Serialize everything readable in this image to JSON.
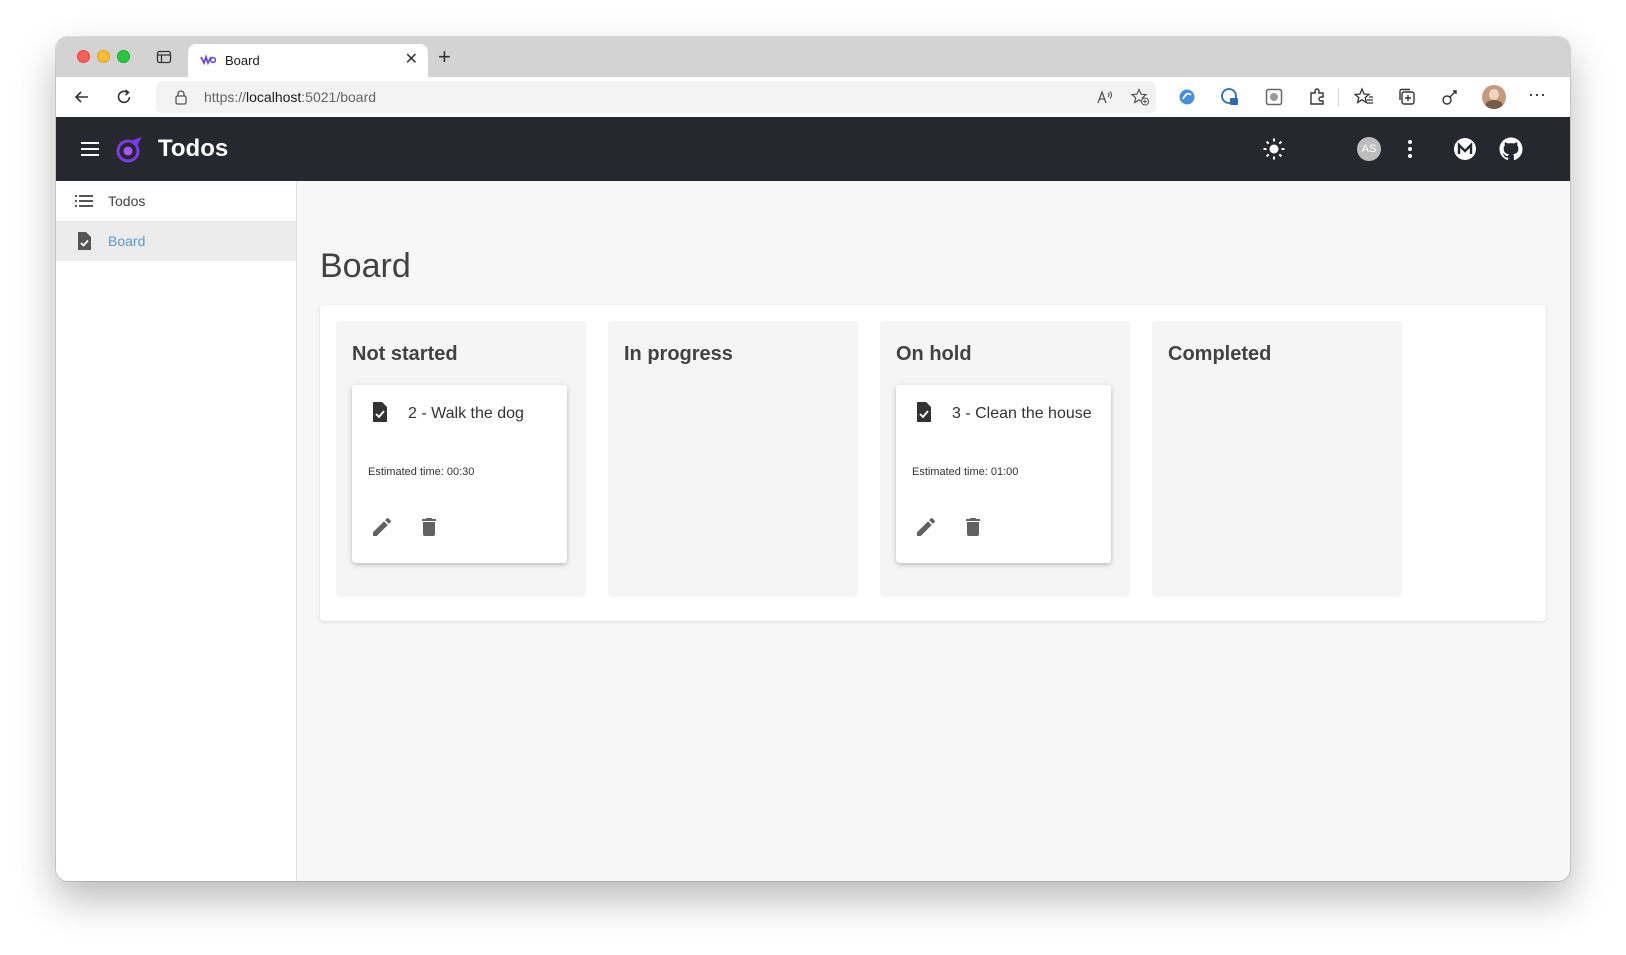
{
  "browser": {
    "tab_title": "Board",
    "url_scheme": "https://",
    "url_host": "localhost",
    "url_rest": ":5021/board"
  },
  "appbar": {
    "title": "Todos",
    "avatar_initials": "AS"
  },
  "drawer": {
    "items": [
      {
        "label": "Todos",
        "icon": "list-icon"
      },
      {
        "label": "Board",
        "icon": "task-file-icon",
        "active": true
      }
    ]
  },
  "page": {
    "title": "Board"
  },
  "board": {
    "columns": [
      {
        "title": "Not started",
        "cards": [
          {
            "title": "2 - Walk the dog",
            "estimate": "Estimated time: 00:30"
          }
        ]
      },
      {
        "title": "In progress",
        "cards": []
      },
      {
        "title": "On hold",
        "cards": [
          {
            "title": "3 - Clean the house",
            "estimate": "Estimated time: 01:00"
          }
        ]
      },
      {
        "title": "Completed",
        "cards": []
      }
    ]
  },
  "colors": {
    "appbar": "#27272f",
    "accent": "#5d9bc8",
    "logo": "#7c3aed"
  }
}
